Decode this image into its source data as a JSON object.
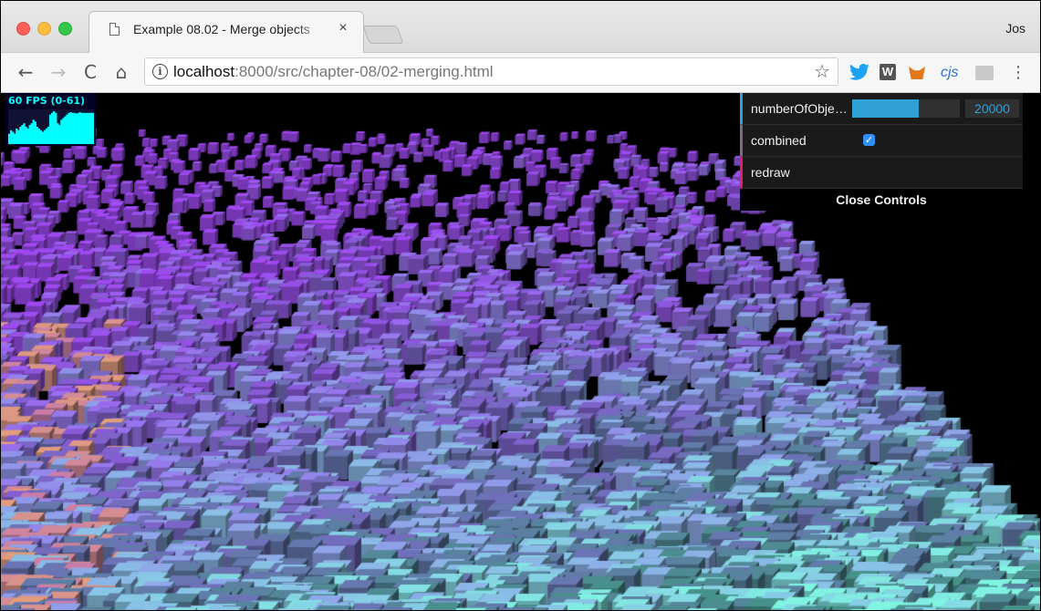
{
  "window": {
    "tab_title": "Example 08.02 - Merge objects",
    "tab_close": "×",
    "profile_name": "Jos"
  },
  "toolbar": {
    "back": "←",
    "forward": "→",
    "reload": "C",
    "home": "⌂",
    "info": "i",
    "url_host": "localhost",
    "url_rest": ":8000/src/chapter-08/02-merging.html",
    "bookmark_star": "☆",
    "extensions": [
      "twitter-icon",
      "w-icon",
      "fox-icon",
      "cjs-icon",
      "extension-icon"
    ],
    "ext_w_label": "W",
    "ext_cjs_label": "cjs",
    "menu": "⋮"
  },
  "stats": {
    "label": "60 FPS (0-61)",
    "color": "#00ffff",
    "history": [
      0.3,
      0.4,
      0.35,
      0.3,
      0.45,
      0.4,
      0.5,
      0.55,
      0.6,
      0.5,
      0.45,
      0.55,
      0.6,
      0.7,
      0.65,
      0.5,
      0.45,
      0.4,
      0.35,
      0.4,
      0.45,
      0.5,
      0.85,
      0.9,
      0.95,
      0.9,
      0.6,
      0.55,
      0.7,
      0.75,
      0.8,
      0.85,
      0.9,
      0.92,
      0.9,
      0.9,
      0.88,
      0.9,
      0.92,
      0.9,
      0.9,
      0.9,
      0.9,
      0.9,
      0.9,
      0.9
    ]
  },
  "controls": {
    "number_label": "numberOfObje…",
    "number_value": "20000",
    "number_fraction": 0.62,
    "combined_label": "combined",
    "combined_checked": true,
    "check_mark": "✓",
    "redraw_label": "redraw",
    "close_label": "Close Controls",
    "colors": {
      "number_accent": "#2fa1d6",
      "bool_accent": "#806787",
      "function_accent": "#e61d5f"
    }
  },
  "scene": {
    "background": "#000000",
    "cube_colors": [
      "#8a3fd1",
      "#6a2fb0",
      "#4fa79a",
      "#6fd3c4",
      "#3d7f78",
      "#c58a6a"
    ]
  }
}
